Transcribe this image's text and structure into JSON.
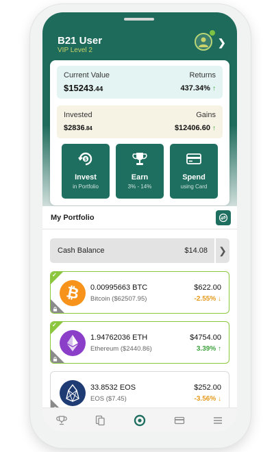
{
  "user": {
    "name": "B21 User",
    "level": "VIP Level 2"
  },
  "summary": {
    "current_label": "Current Value",
    "current_value_main": "$15243",
    "current_value_decimal": ".44",
    "returns_label": "Returns",
    "returns_value": "437.34%",
    "invested_label": "Invested",
    "invested_value_main": "$2836",
    "invested_value_decimal": ".84",
    "gains_label": "Gains",
    "gains_value": "$12406.60"
  },
  "actions": [
    {
      "title": "Invest",
      "subtitle": "in Portfolio",
      "icon": "invest-icon"
    },
    {
      "title": "Earn",
      "subtitle": "3% - 14%",
      "icon": "trophy-icon"
    },
    {
      "title": "Spend",
      "subtitle": "using Card",
      "icon": "card-icon"
    }
  ],
  "portfolio": {
    "title": "My Portfolio",
    "cash_label": "Cash Balance",
    "cash_value": "$14.08"
  },
  "coins": [
    {
      "amount": "0.00995663 BTC",
      "name": "Bitcoin ($62507.95)",
      "value": "$622.00",
      "change": "-2.55%",
      "direction": "down",
      "color": "#f7931a"
    },
    {
      "amount": "1.94762036 ETH",
      "name": "Ethereum ($2440.86)",
      "value": "$4754.00",
      "change": "3.39%",
      "direction": "up",
      "color": "#8b3fc9"
    },
    {
      "amount": "33.8532 EOS",
      "name": "EOS ($7.45)",
      "value": "$252.00",
      "change": "-3.56%",
      "direction": "down",
      "color": "#1e3b73"
    }
  ],
  "colors": {
    "brand": "#1f6f60",
    "accent": "#8cc63f",
    "gain": "#3fa33f",
    "loss": "#e59a1c"
  },
  "tabs": [
    "trophy-icon",
    "exchange-icon",
    "home-icon",
    "card-icon",
    "menu-icon"
  ]
}
